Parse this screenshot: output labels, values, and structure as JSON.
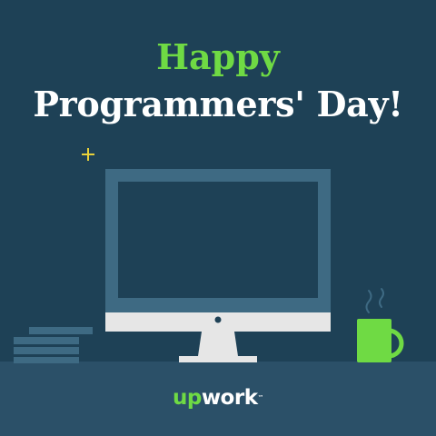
{
  "headline": {
    "line1": "Happy",
    "line2": "Programmers' Day!"
  },
  "logo": {
    "brand_a": "up",
    "brand_b": "work",
    "trademark": "™"
  },
  "colors": {
    "background": "#1e4156",
    "floor": "#2b5068",
    "accent_green": "#6fda44",
    "monitor_frame": "#3e6a83",
    "monitor_stand": "#e6e6e6",
    "sparkle": "#e8d13a"
  },
  "icons": [
    "sparkle-icon",
    "desktop-computer-icon",
    "coffee-mug-icon",
    "steam-icon",
    "book-stack-icon"
  ]
}
